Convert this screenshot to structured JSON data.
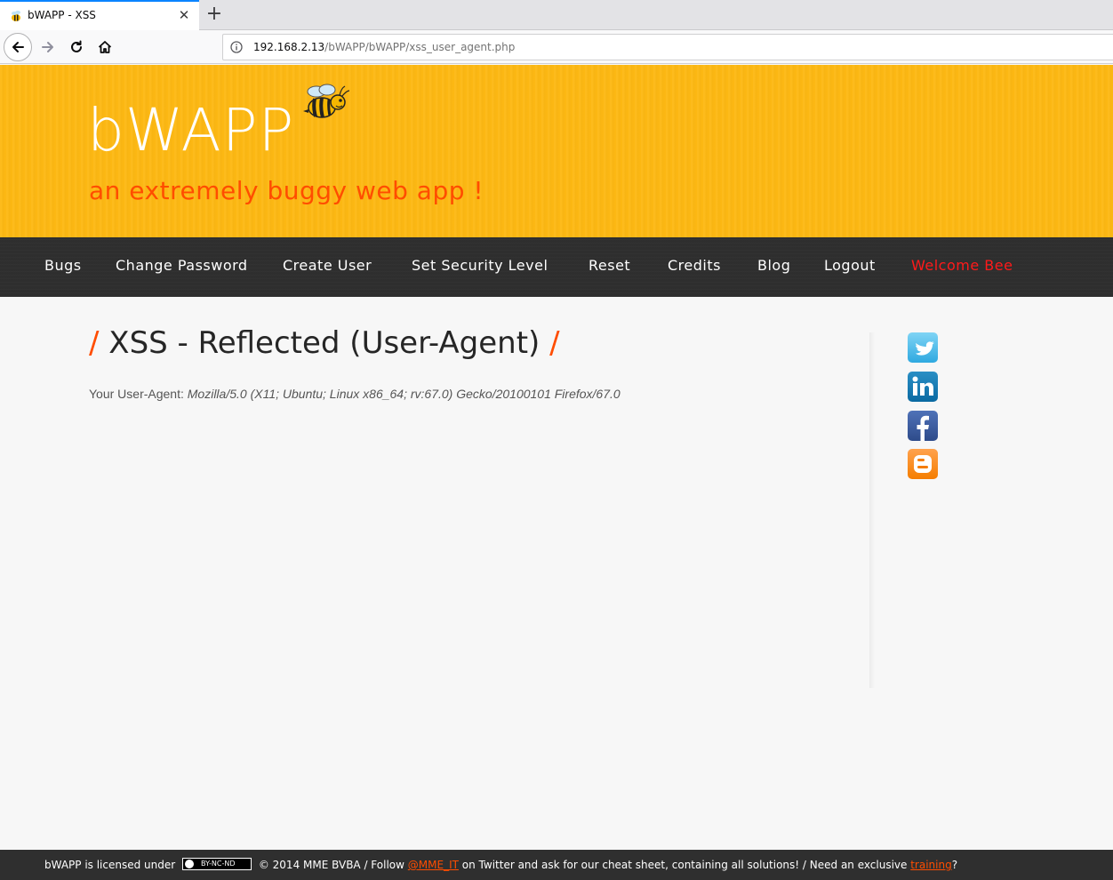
{
  "browser": {
    "tab_title": "bWAPP - XSS",
    "url_host": "192.168.2.13",
    "url_path": "/bWAPP/bWAPP/xss_user_agent.php"
  },
  "header": {
    "logo": "bWAPP",
    "tagline": "an extremely buggy web app !"
  },
  "menu": {
    "items": [
      "Bugs",
      "Change Password",
      "Create User",
      "Set Security Level",
      "Reset",
      "Credits",
      "Blog",
      "Logout"
    ],
    "welcome": "Welcome Bee"
  },
  "main": {
    "title_slash_left": "/",
    "title": "XSS - Reflected (User-Agent)",
    "title_slash_right": "/",
    "ua_label": "Your User-Agent:",
    "ua_value": "Mozilla/5.0 (X11; Ubuntu; Linux x86_64; rv:67.0) Gecko/20100101 Firefox/67.0"
  },
  "social": {
    "icons": [
      "twitter-icon",
      "linkedin-icon",
      "facebook-icon",
      "blogger-icon"
    ]
  },
  "footer": {
    "part1": "bWAPP is licensed under",
    "cc_badge": "BY-NC-ND",
    "part2": "© 2014 MME BVBA / Follow",
    "twitter_link": "@MME_IT",
    "part3": "on Twitter and ask for our cheat sheet, containing all solutions! / Need an exclusive",
    "training_link": "training",
    "part4": "?"
  },
  "colors": {
    "header_bg": "#fdb813",
    "accent": "#ff4d00",
    "menu_bg": "#2f2f2f",
    "welcome": "#ff1a1a"
  }
}
